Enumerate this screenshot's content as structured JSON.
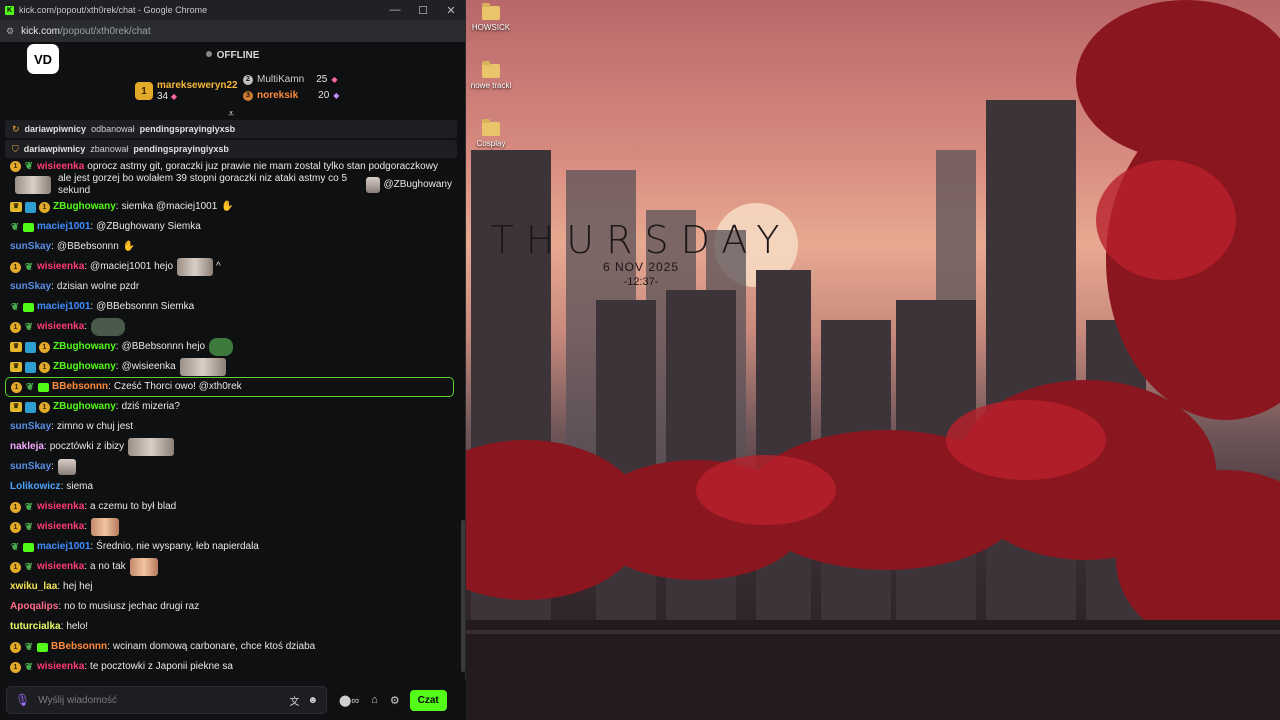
{
  "window": {
    "title": "kick.com/popout/xth0rek/chat - Google Chrome",
    "url_host": "kick.com",
    "url_path": "/popout/xth0rek/chat",
    "minimize": "—",
    "maximize": "☐",
    "close": "✕"
  },
  "header": {
    "logo": "VD",
    "status": "OFFLINE",
    "leaders": [
      {
        "rank": "1",
        "name": "marekseweryn22",
        "count": "34"
      },
      {
        "rank": "2",
        "name": "MultiKamn",
        "count": "25"
      },
      {
        "rank": "3",
        "name": "noreksik",
        "count": "20"
      }
    ]
  },
  "system_messages": [
    {
      "actor": "dariawpiwnicy",
      "action": "odbanował",
      "target": "pendingsprayingiyxsb"
    },
    {
      "actor": "dariawpiwnicy",
      "action": "zbanował",
      "target": "pendingsprayingiyxsb"
    }
  ],
  "messages": [
    {
      "user": "wisieenka",
      "text": "oprocz astmy git, goraczki juz prawie nie mam zostal tylko stan podgoraczkowy",
      "text2": "ale jest gorzej bo wolałem 39 stopni goraczki niz ataki astmy co 5 sekund",
      "mention": "@ZBughowany"
    },
    {
      "user": "ZBughowany",
      "text": "siemka @maciej1001"
    },
    {
      "user": "maciej1001",
      "text": "@ZBughowany Siemka"
    },
    {
      "user": "sunSkay",
      "text": "@BBebsonnn"
    },
    {
      "user": "wisieenka",
      "text": "@maciej1001 hejo",
      "extra": "^"
    },
    {
      "user": "sunSkay",
      "text": "dzisian wolne pzdr"
    },
    {
      "user": "maciej1001",
      "text": "@BBebsonnn Siemka"
    },
    {
      "user": "wisieenka",
      "text": ""
    },
    {
      "user": "ZBughowany",
      "text": "@BBebsonnn hejo"
    },
    {
      "user": "ZBughowany",
      "text": "@wisieenka"
    },
    {
      "user": "BBebsonnn",
      "text": "Cześć Thorci owo! @xth0rek"
    },
    {
      "user": "ZBughowany",
      "text": "dziś mizeria?"
    },
    {
      "user": "sunSkay",
      "text": "zimno w chuj jest"
    },
    {
      "user": "nakleja",
      "text": "pocztówki z ibizy"
    },
    {
      "user": "sunSkay",
      "text": ""
    },
    {
      "user": "Lolikowicz",
      "text": "siema"
    },
    {
      "user": "wisieenka",
      "text": "a czemu to był blad"
    },
    {
      "user": "wisieenka",
      "text": ""
    },
    {
      "user": "maciej1001",
      "text": "Średnio, nie wyspany, łeb napierdala"
    },
    {
      "user": "wisieenka",
      "text": "a no tak"
    },
    {
      "user": "xwiku_laa",
      "text": "hej hej"
    },
    {
      "user": "Apoqalips",
      "text": "no to musiusz jechac drugi raz"
    },
    {
      "user": "tuturcialka",
      "text": "helo!"
    },
    {
      "user": "BBebsonnn",
      "text": "wcinam domową carbonare, chce ktoś dziaba"
    },
    {
      "user": "wisieenka",
      "text": "te pocztowki z Japonii piekne sa"
    }
  ],
  "input": {
    "placeholder": "Wyślij wiadomość",
    "send_label": "Czat"
  },
  "desktop": {
    "icons": [
      "HOWSICK",
      "nowe tracki",
      "Cosplay"
    ],
    "day": "THURSDAY",
    "date": "6 NOV 2025",
    "time": "-12:37-"
  },
  "colors": {
    "accent": "#53fc18",
    "background": "#0f1012",
    "system_bg": "#1e1f22"
  }
}
